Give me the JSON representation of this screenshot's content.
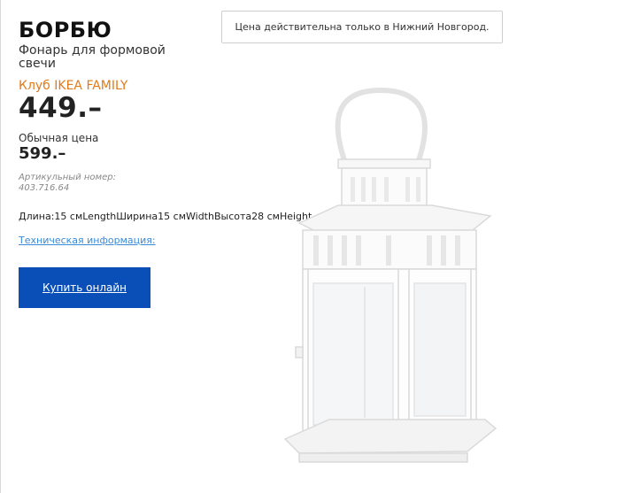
{
  "product": {
    "name": "БОРБЮ",
    "description": "Фонарь для формовой свечи",
    "family_label": "Клуб IKEA FAMILY",
    "family_price": "449.–",
    "regular_label": "Обычная цена",
    "regular_price": "599.–",
    "article": "Артикульный номер: 403.716.64",
    "dimensions": "Длина:15 смLengthШирина15 смWidthВысота28 смHeight",
    "tech_info_link": "Техническая информация:",
    "buy_button": "Купить онлайн"
  },
  "notice": {
    "text": "Цена действительна только в Нижний Новгород."
  },
  "image": {
    "icon": "lantern-image"
  },
  "colors": {
    "family_orange": "#e07a1a",
    "button_blue": "#0a4fb8",
    "link_blue": "#3a8bd8"
  }
}
